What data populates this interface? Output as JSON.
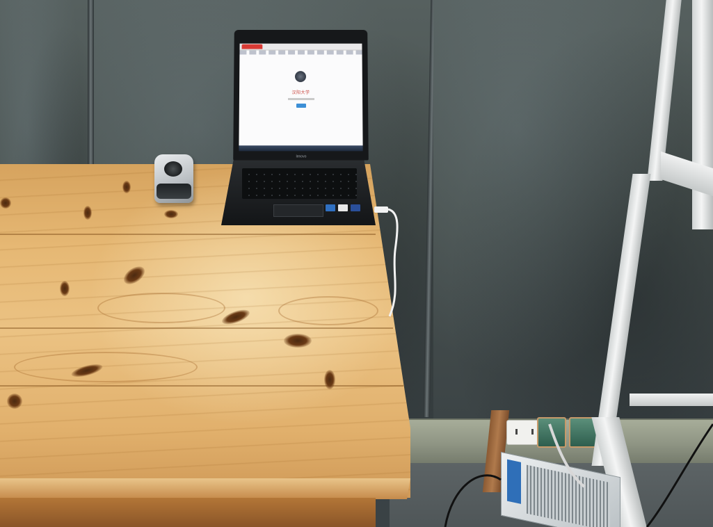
{
  "scene": {
    "description_items": [
      "wooden-table",
      "laptop",
      "fingerprint-scanner",
      "usb-cable",
      "wall-panels",
      "power-sockets",
      "metal-shelf",
      "floor-device"
    ]
  },
  "laptop": {
    "brand": "lenovo",
    "screen": {
      "heading": "汉阳大学"
    }
  },
  "colors": {
    "wall": "#4a5356",
    "table_wood": "#e6b874",
    "laptop_body": "#1c1f21",
    "screen_bg": "#fbfbfc",
    "browser_tab": "#d93a34",
    "screen_button": "#3c8fd6",
    "baseboard": "#a7ad99",
    "shelf": "#eef0f0",
    "cable": "#f2f2f2"
  }
}
